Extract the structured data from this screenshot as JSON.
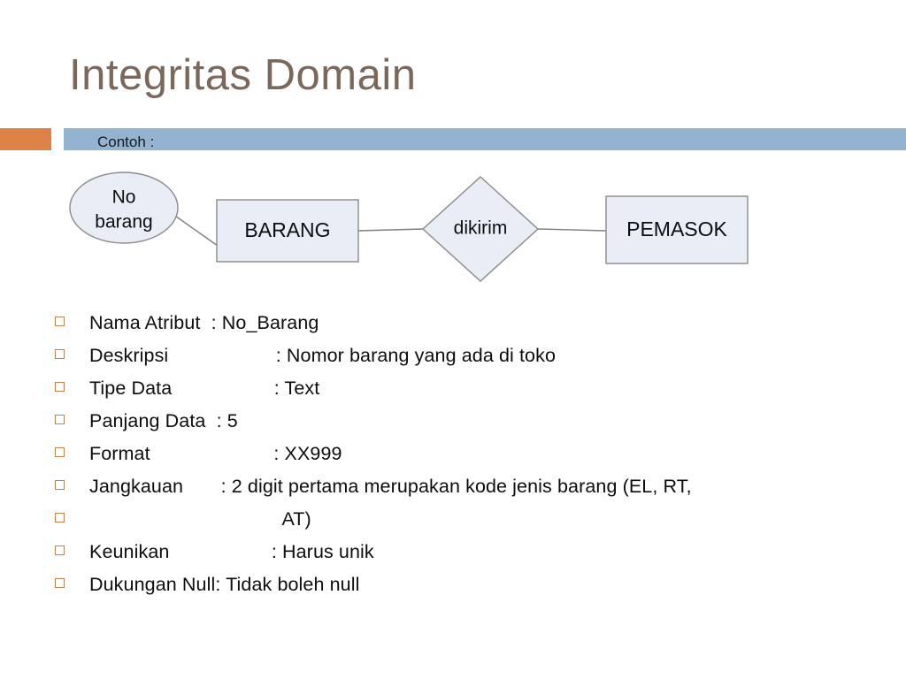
{
  "slide": {
    "title": "Integritas Domain",
    "example_label": "Contoh :",
    "colors": {
      "title": "#7b685c",
      "accent_orange": "#dd8247",
      "accent_blue": "#93b3d1",
      "bullet_orange": "#c4804f",
      "shape_fill": "#e8edf6",
      "shape_stroke": "#8a8a8a",
      "text": "#0d0d0d"
    }
  },
  "diagram": {
    "attribute_ellipse": {
      "line1": "No",
      "line2": "barang"
    },
    "entity_left": "BARANG",
    "relationship": "dikirim",
    "entity_right": "PEMASOK"
  },
  "details": [
    {
      "text": "Nama Atribut  : No_Barang"
    },
    {
      "text": "Deskripsi                    : Nomor barang yang ada di toko"
    },
    {
      "text": "Tipe Data                   : Text"
    },
    {
      "text": "Panjang Data  : 5"
    },
    {
      "text": "Format                       : XX999"
    },
    {
      "text": "Jangkauan       : 2 digit pertama merupakan kode jenis barang (EL, RT,"
    },
    {
      "text": "                                    AT)"
    },
    {
      "text": "Keunikan                   : Harus unik"
    },
    {
      "text": "Dukungan Null: Tidak boleh null"
    }
  ]
}
